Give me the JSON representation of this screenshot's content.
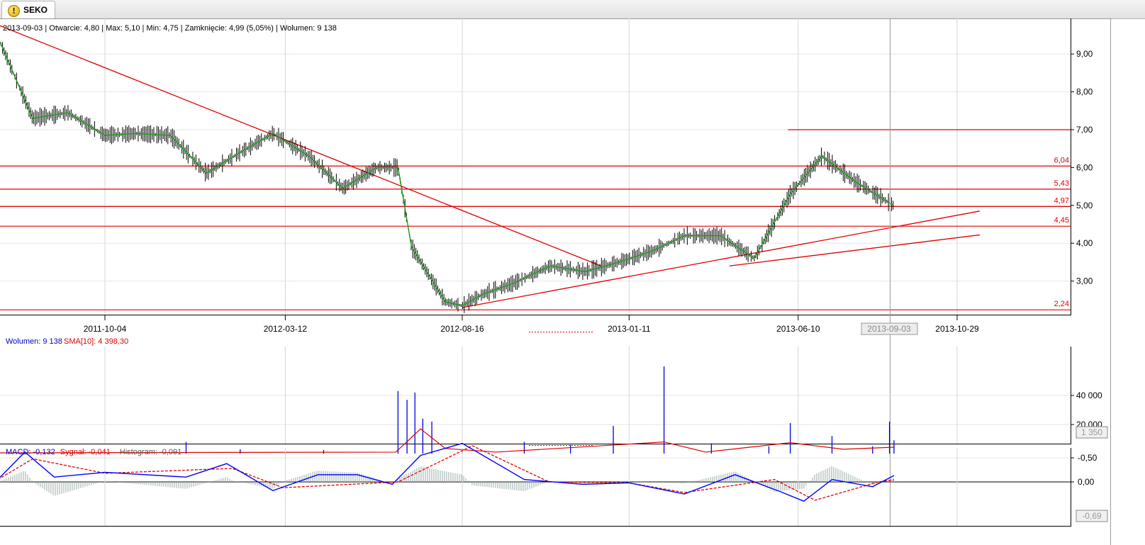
{
  "tab": {
    "label": "SEKO",
    "icon": "warning-icon"
  },
  "price_panel": {
    "info_date": "2013-09-03",
    "info_rest": "| Otwarcie: 4,80 | Max: 5,10 | Min: 4,75 | Zamknięcie: 4,99 (5,05%)  | Wolumen: 9 138",
    "cursor_date": "2013-09-03"
  },
  "volume_panel": {
    "label": "Wolumen: 9 138",
    "sma_label": "SMA[10]: 4 398,30",
    "current_label": "1 350"
  },
  "macd_panel": {
    "macd_label": "MACD: -0,132",
    "signal_label": "Sygnał: -0,041",
    "histogram_label": "Histogram: -0,091",
    "current_label": "-0,69"
  },
  "colors": {
    "support_lines": "#e00000",
    "sma": "#1a9c1a",
    "candles": "#000000",
    "volume": "#0000dd",
    "macd": "#0000ff",
    "signal": "#e00000",
    "histogram": "#9aa9a9"
  },
  "chart_data": [
    {
      "type": "candlestick",
      "title": "",
      "x_ticks": [
        "2011-10-04",
        "2012-03-12",
        "2012-08-16",
        "2013-01-11",
        "2013-06-10",
        "2013-10-29"
      ],
      "y_ticks": [
        "3,00",
        "4,00",
        "5,00",
        "6,00",
        "7,00",
        "8,00",
        "9,00"
      ],
      "ylim": [
        2.2,
        9.8
      ],
      "grid": true,
      "horizontal_levels": [
        {
          "value": 6.04,
          "label": "6,04"
        },
        {
          "value": 5.43,
          "label": "5,43"
        },
        {
          "value": 4.97,
          "label": "4,97"
        },
        {
          "value": 4.45,
          "label": "4,45"
        },
        {
          "value": 2.24,
          "label": "2,24"
        },
        {
          "value": 7.0,
          "label": ""
        }
      ],
      "trend_lines": [
        {
          "from": [
            "2011-06-20",
            9.9
          ],
          "to": [
            "2012-12-17",
            3.4
          ]
        },
        {
          "from": [
            "2012-08-16",
            2.3
          ],
          "to": [
            "2013-11-18",
            4.85
          ]
        },
        {
          "from": [
            "2013-04-10",
            3.4
          ],
          "to": [
            "2013-11-18",
            4.22
          ]
        }
      ],
      "series": [
        {
          "name": "",
          "x": [
            "2011-07-01",
            "2011-08-01",
            "2011-09-01",
            "2011-10-04",
            "2011-11-01",
            "2011-12-01",
            "2012-01-02",
            "2012-02-01",
            "2012-03-01",
            "2012-04-02",
            "2012-05-02",
            "2012-06-01",
            "2012-06-20",
            "2012-07-02",
            "2012-08-01",
            "2012-08-16",
            "2012-09-03",
            "2012-10-01",
            "2012-11-02",
            "2012-12-03",
            "2013-01-02",
            "2013-02-01",
            "2013-03-01",
            "2013-04-02",
            "2013-05-02",
            "2013-06-03",
            "2013-07-01",
            "2013-08-01",
            "2013-09-03"
          ],
          "values": [
            9.45,
            7.3,
            7.45,
            6.85,
            6.9,
            6.85,
            5.85,
            6.4,
            6.9,
            6.3,
            5.45,
            6.0,
            6.0,
            3.9,
            2.45,
            2.35,
            2.65,
            2.95,
            3.4,
            3.25,
            3.5,
            3.8,
            4.2,
            4.2,
            3.6,
            5.3,
            6.3,
            5.6,
            4.99
          ]
        }
      ]
    },
    {
      "type": "bar",
      "title": "",
      "y_ticks": [
        "20 000",
        "40 000"
      ],
      "ylim": [
        0,
        60000
      ],
      "series": [
        {
          "name": "Wolumen",
          "x": [
            "2011-07-01",
            "2011-10-04",
            "2011-12-15",
            "2012-02-01",
            "2012-04-15",
            "2012-06-20",
            "2012-06-28",
            "2012-07-05",
            "2012-07-12",
            "2012-07-20",
            "2012-08-16",
            "2012-10-10",
            "2012-11-20",
            "2012-12-28",
            "2013-02-11",
            "2013-03-25",
            "2013-05-15",
            "2013-06-03",
            "2013-07-10",
            "2013-08-15",
            "2013-08-30",
            "2013-09-03"
          ],
          "values": [
            1200,
            2500,
            8000,
            3000,
            2500,
            43000,
            37000,
            42000,
            24000,
            22000,
            3500,
            8000,
            6000,
            19000,
            60000,
            7000,
            5000,
            21000,
            12000,
            5000,
            22000,
            9138
          ]
        },
        {
          "name": "SMA[10]",
          "x": [
            "2011-07-01",
            "2012-06-18",
            "2012-07-10",
            "2012-08-01",
            "2012-09-15",
            "2013-02-11",
            "2013-03-20",
            "2013-06-03",
            "2013-07-20",
            "2013-09-03"
          ],
          "values": [
            500,
            1000,
            17000,
            3500,
            1000,
            8000,
            1000,
            7500,
            3000,
            4398.3
          ]
        }
      ]
    },
    {
      "type": "line",
      "title": "",
      "y_ticks": [
        "0,00",
        "-0,50"
      ],
      "ylim": [
        -0.8,
        0.5
      ],
      "series": [
        {
          "name": "MACD",
          "x": [
            "2011-07-01",
            "2011-07-25",
            "2011-08-20",
            "2011-10-04",
            "2011-12-15",
            "2012-01-20",
            "2012-03-01",
            "2012-04-10",
            "2012-05-15",
            "2012-06-15",
            "2012-07-10",
            "2012-08-16",
            "2012-10-10",
            "2012-12-01",
            "2013-01-11",
            "2013-03-01",
            "2013-04-15",
            "2013-05-25",
            "2013-06-15",
            "2013-07-10",
            "2013-08-15",
            "2013-09-03"
          ],
          "values": [
            -0.05,
            -0.62,
            -0.1,
            -0.2,
            -0.1,
            -0.38,
            0.18,
            -0.15,
            -0.15,
            0.05,
            -0.55,
            -0.8,
            -0.05,
            0.05,
            0.02,
            0.25,
            -0.15,
            0.2,
            0.4,
            -0.05,
            0.1,
            -0.132
          ]
        },
        {
          "name": "Sygnał",
          "x": [
            "2011-07-01",
            "2011-08-01",
            "2011-10-04",
            "2012-01-25",
            "2012-03-10",
            "2012-06-20",
            "2012-08-25",
            "2012-11-01",
            "2013-01-11",
            "2013-03-01",
            "2013-05-20",
            "2013-06-25",
            "2013-08-20",
            "2013-09-03"
          ],
          "values": [
            -0.05,
            -0.48,
            -0.18,
            -0.28,
            0.12,
            0.0,
            -0.75,
            0.0,
            0.02,
            0.22,
            -0.05,
            0.38,
            0.0,
            -0.041
          ]
        }
      ]
    }
  ]
}
